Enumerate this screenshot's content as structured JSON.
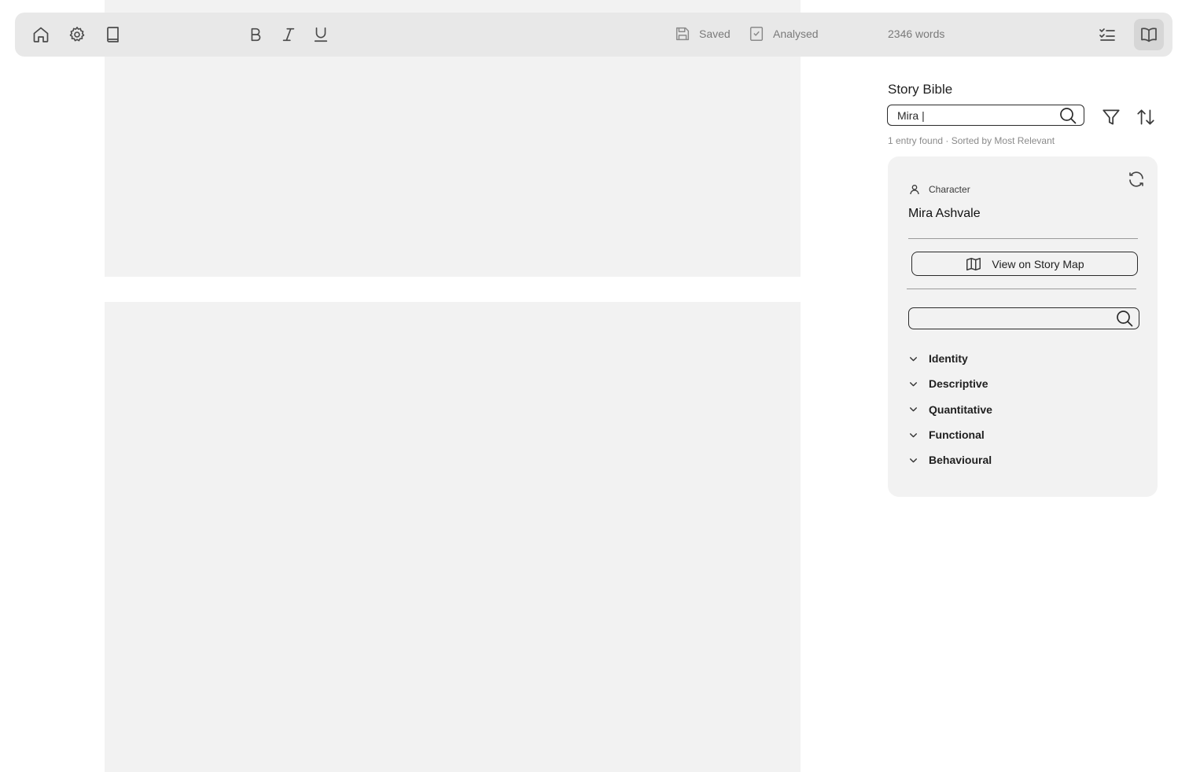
{
  "toolbar": {
    "left_icons": [
      "home-icon",
      "settings-icon",
      "book-icon"
    ],
    "format_icons": [
      "bold-icon",
      "italic-icon",
      "underline-icon"
    ],
    "saved_label": "Saved",
    "analysed_label": "Analysed",
    "word_count": "2346 words",
    "right_icons": [
      "checklist-icon",
      "open-book-icon"
    ]
  },
  "sidebar": {
    "title": "Story Bible",
    "search_value": "Mira |",
    "results_meta": "1 entry found · Sorted by Most Relevant",
    "entry": {
      "type": "Character",
      "name": "Mira Ashvale",
      "map_button": "View on Story Map",
      "search_value": "",
      "sections": [
        "Identity",
        "Descriptive",
        "Quantitative",
        "Functional",
        "Behavioural"
      ]
    }
  },
  "colors": {
    "toolbar_bg": "#e8e8e8",
    "page_bg": "#f2f2f2",
    "card_bg": "#f2f2f2",
    "muted_text": "#7a7a7a"
  }
}
